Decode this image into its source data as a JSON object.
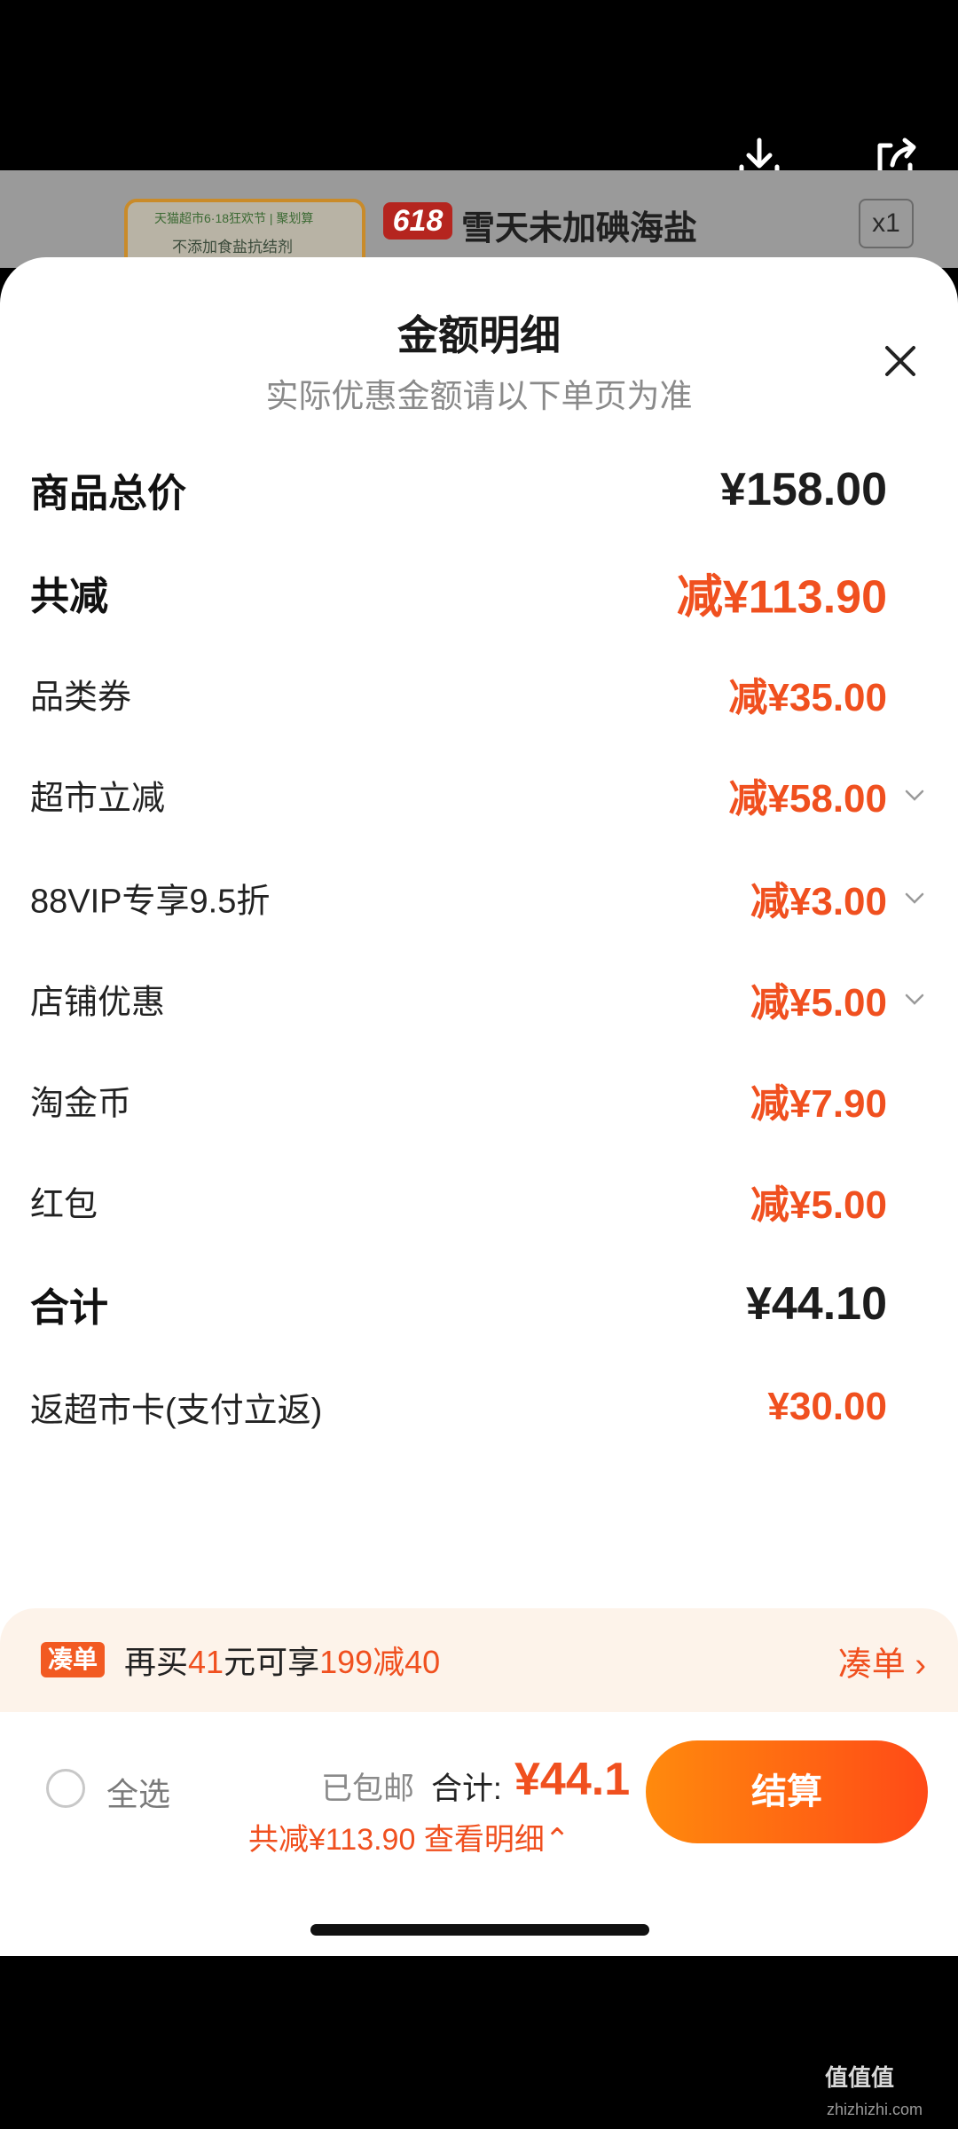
{
  "status_icons": [
    "download-icon",
    "share-icon"
  ],
  "product": {
    "thumb_line1": "天猫超市6·18狂欢节 | 聚划算",
    "thumb_line2": "不添加食盐抗结剂",
    "badge": "618",
    "title": "雪天未加碘海盐",
    "qty": "x1"
  },
  "sheet": {
    "title": "金额明细",
    "subtitle": "实际优惠金额请以下单页为准",
    "rows": [
      {
        "label": "商品总价",
        "value": "¥158.00",
        "style": "big",
        "color": "black",
        "chevron": false
      },
      {
        "label": "共减",
        "value": "减¥113.90",
        "style": "big",
        "color": "orange",
        "chevron": false
      },
      {
        "label": "品类券",
        "value": "减¥35.00",
        "style": "normal",
        "color": "orange",
        "chevron": false
      },
      {
        "label": "超市立减",
        "value": "减¥58.00",
        "style": "normal",
        "color": "orange",
        "chevron": true
      },
      {
        "label": "88VIP专享9.5折",
        "value": "减¥3.00",
        "style": "normal",
        "color": "orange",
        "chevron": true
      },
      {
        "label": "店铺优惠",
        "value": "减¥5.00",
        "style": "normal",
        "color": "orange",
        "chevron": true
      },
      {
        "label": "淘金币",
        "value": "减¥7.90",
        "style": "normal",
        "color": "orange",
        "chevron": false
      },
      {
        "label": "红包",
        "value": "减¥5.00",
        "style": "normal",
        "color": "orange",
        "chevron": false
      },
      {
        "label": "合计",
        "value": "¥44.10",
        "style": "big",
        "color": "black",
        "chevron": false
      },
      {
        "label": "返超市卡(支付立返)",
        "value": "¥30.00",
        "style": "normal",
        "color": "orange",
        "chevron": false
      }
    ]
  },
  "coudan": {
    "tag": "凑单",
    "text_pre": "再买",
    "text_amount": "41",
    "text_mid": "元可享",
    "text_offer": "199减40",
    "link": "凑单 ›"
  },
  "checkout": {
    "select_all": "全选",
    "shipping": "已包邮",
    "total_label": "合计:",
    "total_value": "¥44.1",
    "discount_line": "共减¥113.90  查看明细⌃",
    "pay_button": "结算"
  },
  "watermark": {
    "text": "值值值",
    "sub": "zhizhizhi.com"
  },
  "colors": {
    "accent": "#f0501f",
    "button_start": "#ff8a0d",
    "button_end": "#ff4a17"
  }
}
